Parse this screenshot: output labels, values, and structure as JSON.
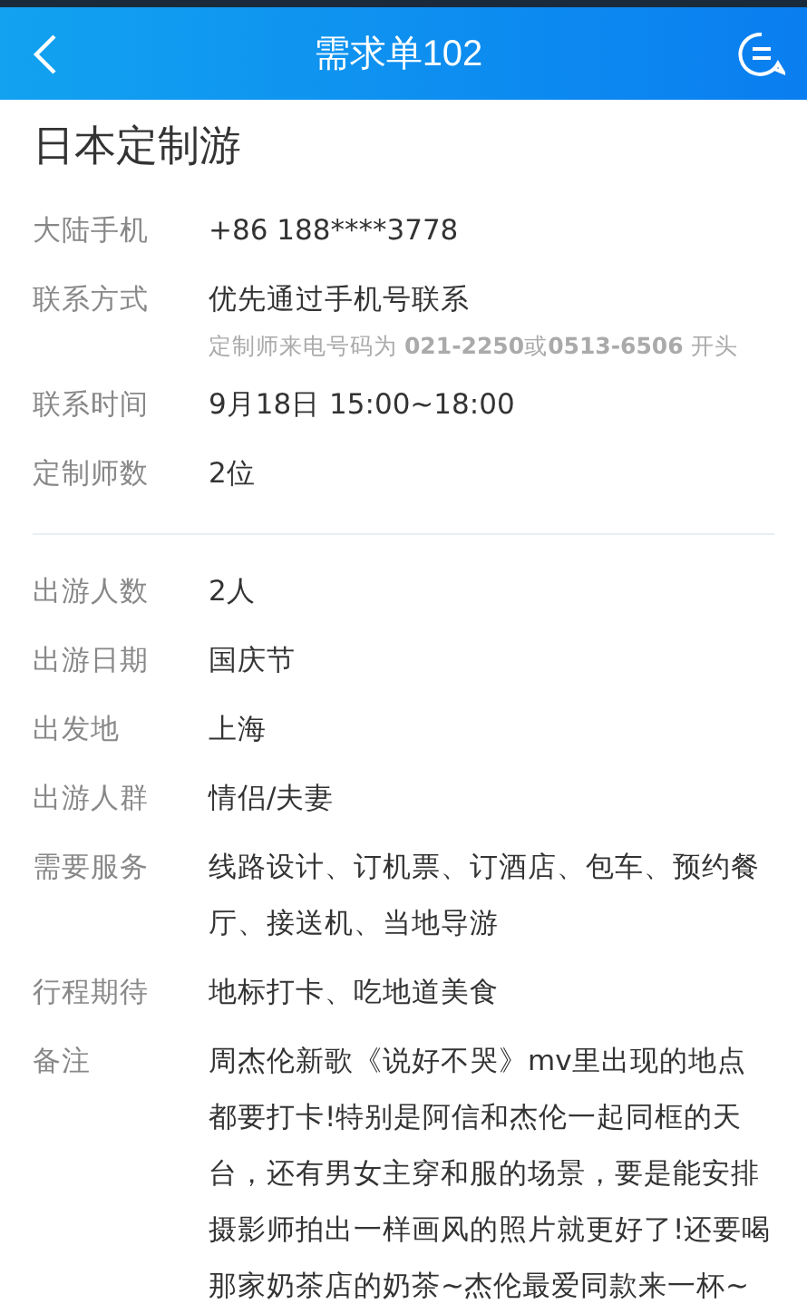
{
  "header": {
    "title": "需求单102"
  },
  "page_title": "日本定制游",
  "sections": [
    {
      "rows": [
        {
          "label": "大陆手机",
          "value": "+86 188****3778"
        },
        {
          "label": "联系方式",
          "value": "优先通过手机号联系",
          "note": "定制师来电号码为 **021-2250**或**0513-6506** 开头"
        },
        {
          "label": "联系时间",
          "value": "9月18日 15:00~18:00"
        },
        {
          "label": "定制师数",
          "value": "2位"
        }
      ]
    },
    {
      "rows": [
        {
          "label": "出游人数",
          "value": "2人"
        },
        {
          "label": "出游日期",
          "value": "国庆节"
        },
        {
          "label": "出发地",
          "value": "上海"
        },
        {
          "label": "出游人群",
          "value": "情侣/夫妻"
        },
        {
          "label": "需要服务",
          "value": "线路设计、订机票、订酒店、包车、预约餐厅、接送机、当地导游"
        },
        {
          "label": "行程期待",
          "value": "地标打卡、吃地道美食"
        },
        {
          "label": "备注",
          "value": "周杰伦新歌《说好不哭》mv里出现的地点都要打卡!特别是阿信和杰伦一起同框的天台，还有男女主穿和服的场景，要是能安排摄影师拍出一样画风的照片就更好了!还要喝那家奶茶店的奶茶~杰伦最爱同款来一杯~"
        }
      ]
    }
  ]
}
